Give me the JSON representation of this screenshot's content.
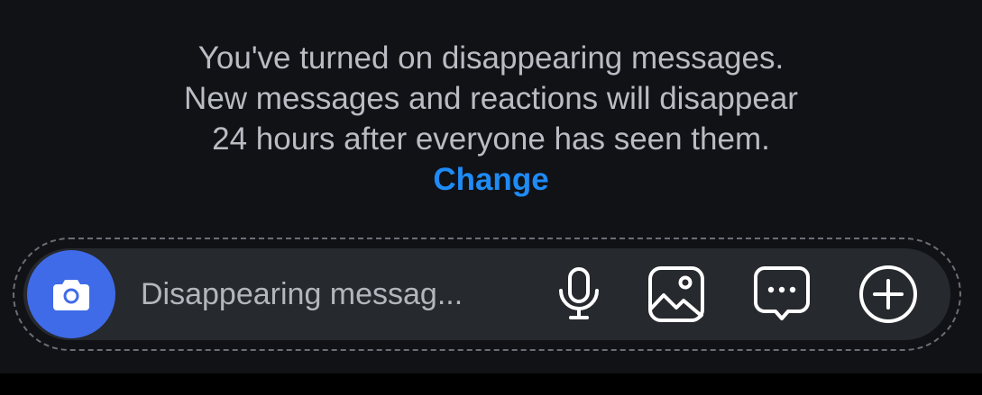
{
  "notice": {
    "line1": "You've turned on disappearing messages.",
    "line2": "New messages and reactions will disappear",
    "line3": "24 hours after everyone has seen them.",
    "change_label": "Change"
  },
  "composer": {
    "placeholder": "Disappearing messag...",
    "icons": {
      "camera": "camera-icon",
      "microphone": "microphone-icon",
      "gallery": "image-icon",
      "sticker": "chat-bubble-icon",
      "more": "plus-circle-icon"
    }
  },
  "colors": {
    "background": "#101216",
    "text": "#b9bcc2",
    "link": "#1f8bf5",
    "camera_button": "#3f6be8",
    "input_background": "#26292e"
  }
}
